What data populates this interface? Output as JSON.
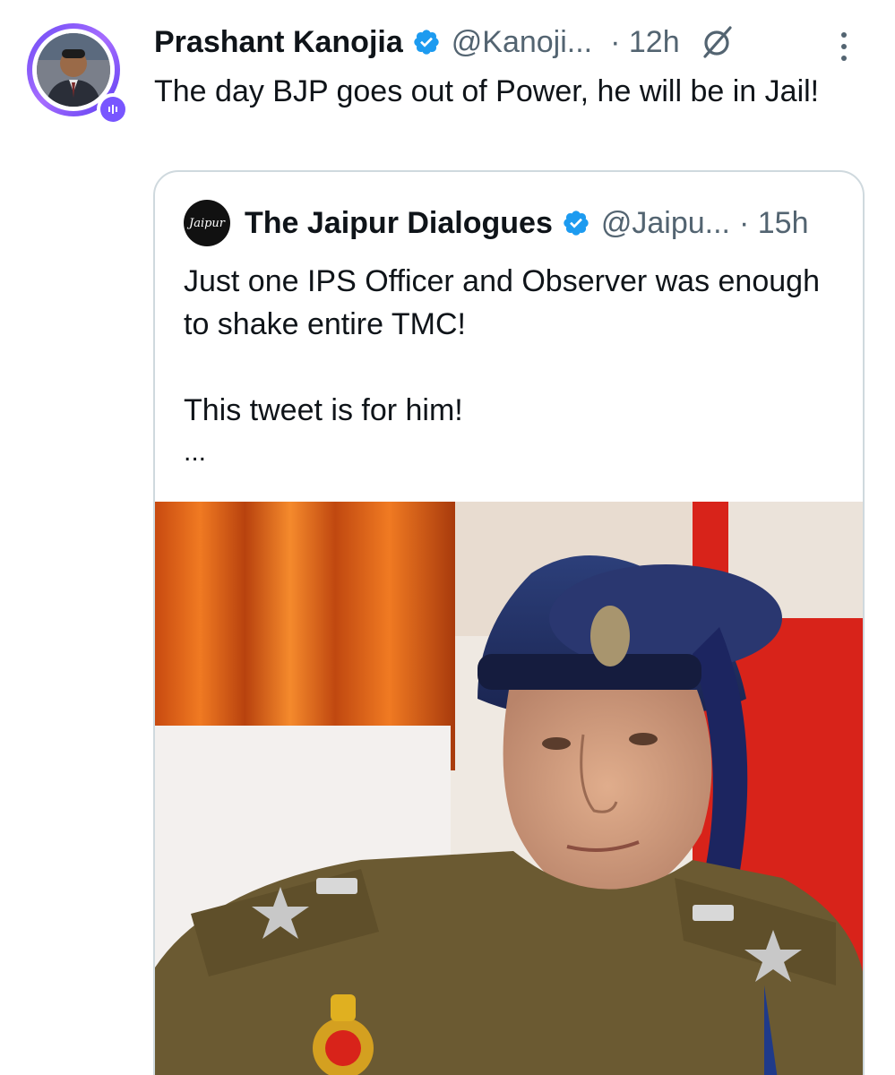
{
  "tweet": {
    "author_name": "Prashant Kanojia",
    "handle": "@Kanoji...",
    "time": "· 12h",
    "text": "The day BJP goes out of Power, he will be in Jail!",
    "icons": {
      "verified": "verified-badge-icon",
      "grok": "grok-icon",
      "more": "more-vertical-icon",
      "avatar_badge": "spaces-live-icon"
    }
  },
  "quoted_tweet": {
    "author_name": "The Jaipur Dialogues",
    "avatar_text": "Jaipur",
    "handle": "@Jaipu...",
    "time": "· 15h",
    "text_line_1": "Just one IPS Officer and Observer was enough to shake entire TMC!",
    "text_line_2": "This tweet is for him!",
    "ellipsis": "...",
    "media_alt": "photo of police officer in uniform and beret"
  },
  "colors": {
    "accent": "#1d9bf0",
    "secondary_text": "#536471",
    "border": "#cfd9de",
    "spaces_purple": "#7856ff"
  }
}
